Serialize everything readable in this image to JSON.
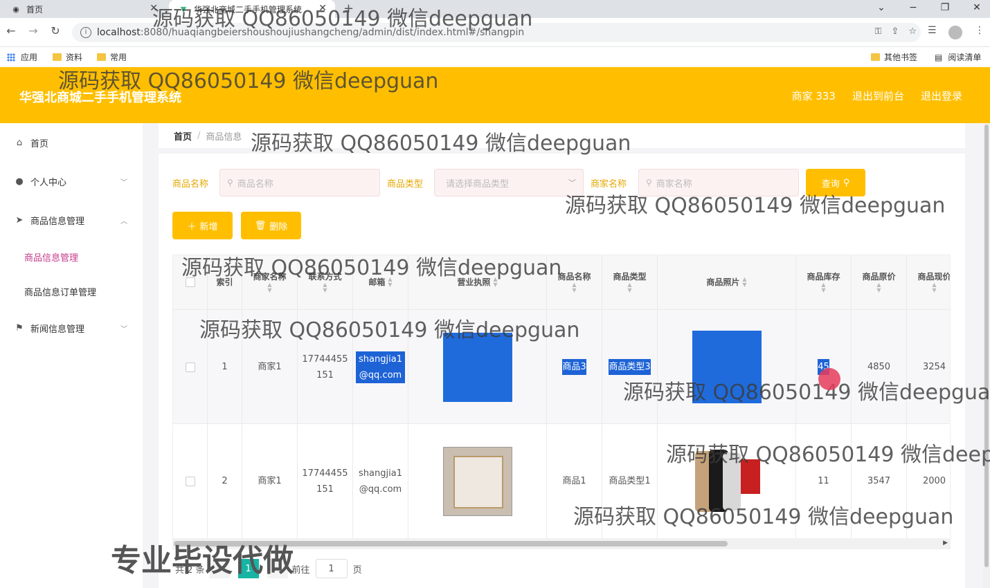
{
  "browser": {
    "tabs": [
      {
        "label": "首页",
        "icon": "globe-icon"
      },
      {
        "label": "华强北商城二手手机管理系统",
        "icon": "vue-icon"
      }
    ],
    "url_host": "localhost",
    "url_rest": ":8080/huaqiangbeiershoushoujiushangcheng/admin/dist/index.html#/shangpin",
    "bookmarks": [
      {
        "label": "应用",
        "icon": "apps-grid-icon"
      },
      {
        "label": "资料",
        "icon": "folder-icon"
      },
      {
        "label": "常用",
        "icon": "folder-icon"
      }
    ],
    "bookmarks_right": [
      {
        "label": "其他书签",
        "icon": "folder-icon"
      },
      {
        "label": "阅读清单",
        "icon": "reading-list-icon"
      }
    ]
  },
  "app": {
    "title": "华强北商城二手手机管理系统",
    "header_links": [
      "商家 333",
      "退出到前台",
      "退出登录"
    ],
    "accent_color": "#ffbf00"
  },
  "sidebar": {
    "items": [
      {
        "label": "首页",
        "icon": "home-icon"
      },
      {
        "label": "个人中心",
        "icon": "user-icon"
      },
      {
        "label": "商品信息管理",
        "icon": "send-icon"
      },
      {
        "label": "新闻信息管理",
        "icon": "flag-icon"
      }
    ],
    "subitems": [
      "商品信息管理",
      "商品信息订单管理"
    ]
  },
  "breadcrumb": {
    "home": "首页",
    "current": "商品信息"
  },
  "filters": {
    "name_label": "商品名称",
    "name_placeholder": "商品名称",
    "type_label": "商品类型",
    "type_placeholder": "请选择商品类型",
    "merchant_label": "商家名称",
    "merchant_placeholder": "商家名称",
    "search_button": "查询"
  },
  "actions": {
    "add": "新增",
    "delete": "删除"
  },
  "table": {
    "headers": [
      "索引",
      "商家名称",
      "联系方式",
      "邮箱",
      "营业执照",
      "商品名称",
      "商品类型",
      "商品照片",
      "商品库存",
      "商品原价",
      "商品现价"
    ],
    "rows": [
      {
        "index": "1",
        "merchant": "商家1",
        "phone": "17744455151",
        "email": "shangjia1@qq.com",
        "name": "商品3",
        "type": "商品类型3",
        "stock": "45",
        "orig_price": "4850",
        "cur_price": "3254"
      },
      {
        "index": "2",
        "merchant": "商家1",
        "phone": "17744455151",
        "email": "shangjia1@qq.com",
        "name": "商品1",
        "type": "商品类型1",
        "stock": "11",
        "orig_price": "3547",
        "cur_price": "2000"
      }
    ]
  },
  "pagination": {
    "total": "共 2 条",
    "current_page": "1",
    "goto_label": "前往",
    "goto_value": "1",
    "page_suffix": "页"
  },
  "watermark": {
    "text": "源码获取 QQ86050149 微信deepguan",
    "big": "专业毕设代做"
  }
}
